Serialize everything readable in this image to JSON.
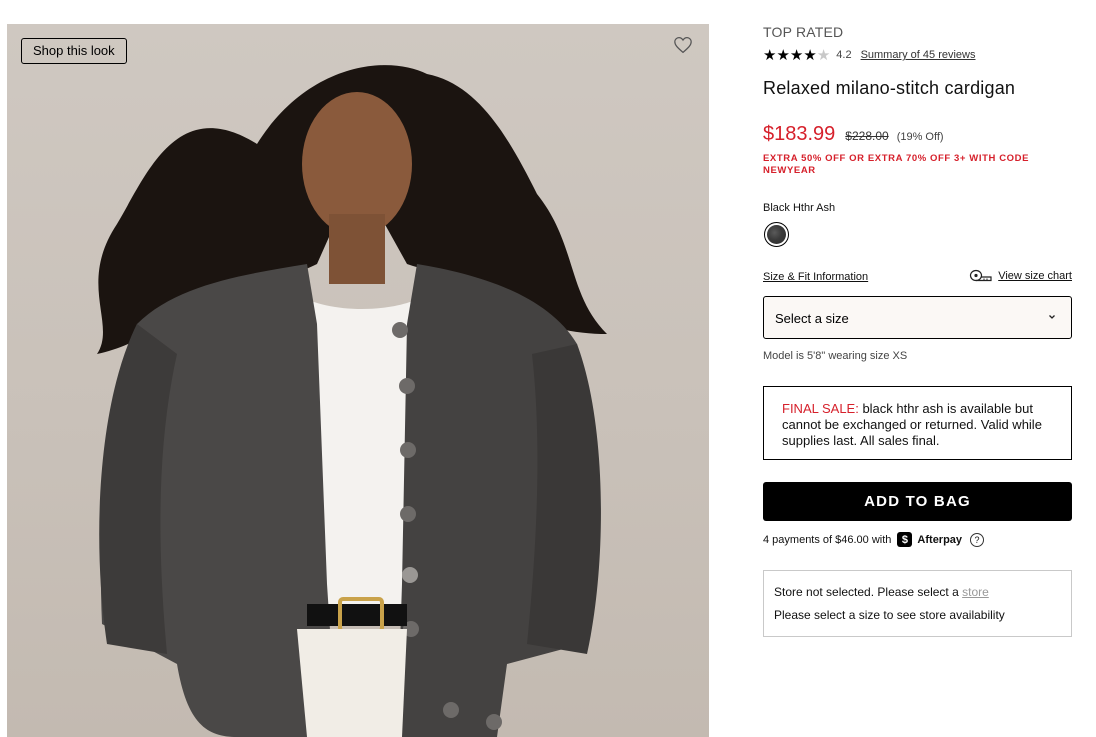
{
  "image": {
    "shop_look_label": "Shop this look",
    "favorite_icon": "heart-outline-icon"
  },
  "product": {
    "badge": "TOP RATED",
    "rating": "4.2",
    "rating_stars": 4.2,
    "review_link": "Summary of 45 reviews",
    "name": "Relaxed milano-stitch cardigan",
    "sale_price": "$183.99",
    "original_price": "$228.00",
    "discount": "(19% Off)",
    "promo": "EXTRA 50% OFF OR EXTRA 70% OFF 3+ WITH CODE NEWYEAR",
    "color_name": "Black Hthr Ash"
  },
  "sizing": {
    "size_fit_link": "Size & Fit Information",
    "size_chart_link": "View size chart",
    "size_chart_icon": "measuring-tape-icon",
    "select_placeholder": "Select a size",
    "model_note": "Model is 5'8\" wearing size XS"
  },
  "final_sale": {
    "label": "FINAL SALE:",
    "text": " black hthr ash is available but cannot be exchanged or returned. Valid while supplies last. All sales final."
  },
  "cart": {
    "add_to_bag": "ADD TO BAG",
    "payments_text": "4 payments of $46.00 with",
    "afterpay_logo": "$",
    "afterpay_name": "Afterpay",
    "help_icon": "?"
  },
  "store": {
    "line1_prefix": "Store not selected. Please select a ",
    "line1_link": "store",
    "line2": "Please select a size to see store availability"
  },
  "colors": {
    "sale_red": "#d6202b",
    "button_black": "#000000",
    "image_bg": "#cfc8c1"
  }
}
